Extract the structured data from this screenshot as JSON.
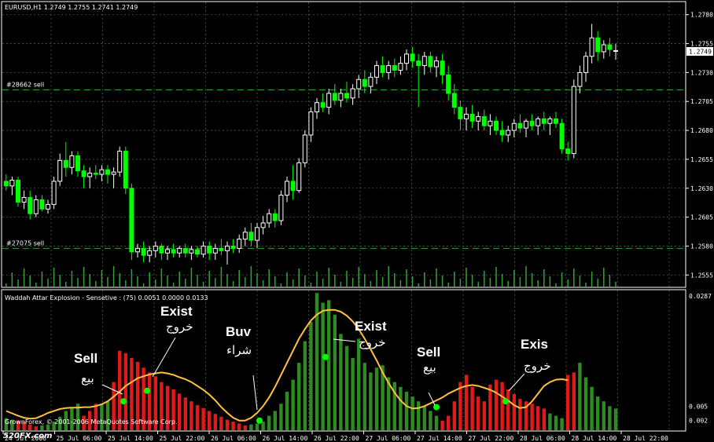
{
  "window": {
    "header": "EURUSD,H1  1.2749 1.2755 1.2741 1.2749",
    "current_price": "1.2749",
    "colors": {
      "background": "#000000",
      "grid": "#4a5a4a",
      "bull": "#ffffff",
      "bear": "#00ff00",
      "oscillator_up": "#2e8b22",
      "oscillator_down": "#e01a1a",
      "signal_line": "#ffc040",
      "marker": "#00ff00",
      "level_line": "#34a234"
    }
  },
  "price_panel": {
    "levels": [
      "1.2780",
      "1.2755",
      "1.2730",
      "1.2705",
      "1.2680",
      "1.2655",
      "1.2630",
      "1.2605",
      "1.2580",
      "1.2555"
    ],
    "level_lines": [
      {
        "label": "#28662 sell",
        "price": 1.2715
      },
      {
        "label": "#27075 sell",
        "price": 1.2578
      }
    ]
  },
  "indicator_panel": {
    "title": "Waddah Attar Explosion - Sensetive : (75)  0.0051 0.0000 0.0133",
    "levels": [
      "0.0287",
      "0.005",
      "0.002"
    ],
    "copyright": "GrownForex, © 2001-2006 MetaQuotes Software Corp."
  },
  "time_axis": [
    "24 Jul 2006",
    "25 Jul 06:00",
    "25 Jul 14:00",
    "25 Jul 22:00",
    "26 Jul 06:00",
    "26 Jul 14:00",
    "26 Jul 22:00",
    "27 Jul 06:00",
    "27 Jul 14:00",
    "27 Jul 22:00",
    "28 Jul 06:00",
    "28 Jul 14:00",
    "28 Jul 22:00"
  ],
  "annotations": [
    {
      "en": "Sell",
      "ar": "بيع"
    },
    {
      "en": "Exist",
      "ar": "خروج"
    },
    {
      "en": "Buv",
      "ar": "شراء"
    },
    {
      "en": "Exist",
      "ar": "خروج"
    },
    {
      "en": "Sell",
      "ar": "بيع"
    },
    {
      "en": "Exis",
      "ar": "خروج"
    }
  ],
  "watermark": "520FX.com",
  "chart_data": {
    "type": "candlestick",
    "symbol": "EURUSD",
    "timeframe": "H1",
    "ylim": [
      1.2545,
      1.279
    ],
    "candles": [
      [
        1.2636,
        1.2642,
        1.2628,
        1.2632
      ],
      [
        1.2632,
        1.264,
        1.2624,
        1.2637
      ],
      [
        1.2637,
        1.264,
        1.2614,
        1.2618
      ],
      [
        1.2618,
        1.2628,
        1.2612,
        1.2622
      ],
      [
        1.2622,
        1.2628,
        1.2603,
        1.2608
      ],
      [
        1.2608,
        1.2624,
        1.2605,
        1.262
      ],
      [
        1.262,
        1.2624,
        1.261,
        1.2612
      ],
      [
        1.2612,
        1.262,
        1.2608,
        1.2616
      ],
      [
        1.2616,
        1.264,
        1.2612,
        1.2636
      ],
      [
        1.2636,
        1.266,
        1.2632,
        1.2654
      ],
      [
        1.2654,
        1.267,
        1.264,
        1.2648
      ],
      [
        1.2648,
        1.2662,
        1.2642,
        1.2658
      ],
      [
        1.2658,
        1.2662,
        1.264,
        1.2645
      ],
      [
        1.2645,
        1.265,
        1.263,
        1.264
      ],
      [
        1.264,
        1.2648,
        1.263,
        1.2643
      ],
      [
        1.2643,
        1.265,
        1.2638,
        1.2642
      ],
      [
        1.2642,
        1.265,
        1.2636,
        1.2646
      ],
      [
        1.2646,
        1.265,
        1.2634,
        1.2642
      ],
      [
        1.2642,
        1.2648,
        1.263,
        1.2644
      ],
      [
        1.2644,
        1.2666,
        1.264,
        1.2662
      ],
      [
        1.2662,
        1.2666,
        1.2625,
        1.263
      ],
      [
        1.263,
        1.2634,
        1.2568,
        1.2575
      ],
      [
        1.2575,
        1.2582,
        1.257,
        1.2578
      ],
      [
        1.2578,
        1.2584,
        1.2566,
        1.2572
      ],
      [
        1.2572,
        1.258,
        1.2566,
        1.2576
      ],
      [
        1.2576,
        1.2584,
        1.257,
        1.258
      ],
      [
        1.258,
        1.2582,
        1.2568,
        1.2574
      ],
      [
        1.2574,
        1.258,
        1.2568,
        1.2577
      ],
      [
        1.2577,
        1.2582,
        1.257,
        1.2574
      ],
      [
        1.2574,
        1.258,
        1.257,
        1.2578
      ],
      [
        1.2578,
        1.2582,
        1.257,
        1.2574
      ],
      [
        1.2574,
        1.258,
        1.2568,
        1.2577
      ],
      [
        1.2577,
        1.258,
        1.257,
        1.2573
      ],
      [
        1.2573,
        1.2584,
        1.257,
        1.258
      ],
      [
        1.258,
        1.2584,
        1.2568,
        1.2574
      ],
      [
        1.2574,
        1.2582,
        1.2568,
        1.2578
      ],
      [
        1.2578,
        1.2586,
        1.2572,
        1.2576
      ],
      [
        1.2576,
        1.2584,
        1.2564,
        1.258
      ],
      [
        1.258,
        1.2586,
        1.2574,
        1.2578
      ],
      [
        1.2578,
        1.259,
        1.2574,
        1.2586
      ],
      [
        1.2586,
        1.2596,
        1.258,
        1.2592
      ],
      [
        1.2592,
        1.26,
        1.258,
        1.2585
      ],
      [
        1.2585,
        1.26,
        1.2578,
        1.2596
      ],
      [
        1.2596,
        1.2606,
        1.259,
        1.26
      ],
      [
        1.26,
        1.2612,
        1.2596,
        1.2608
      ],
      [
        1.2608,
        1.2612,
        1.2596,
        1.2602
      ],
      [
        1.2602,
        1.2628,
        1.2598,
        1.2624
      ],
      [
        1.2624,
        1.264,
        1.2618,
        1.2636
      ],
      [
        1.2636,
        1.265,
        1.262,
        1.2628
      ],
      [
        1.2628,
        1.2656,
        1.2626,
        1.2652
      ],
      [
        1.2652,
        1.268,
        1.2648,
        1.2676
      ],
      [
        1.2676,
        1.27,
        1.267,
        1.2696
      ],
      [
        1.2696,
        1.2708,
        1.269,
        1.2704
      ],
      [
        1.2704,
        1.2712,
        1.2696,
        1.27
      ],
      [
        1.27,
        1.2716,
        1.2694,
        1.2712
      ],
      [
        1.2712,
        1.272,
        1.2702,
        1.2706
      ],
      [
        1.2706,
        1.2716,
        1.27,
        1.2712
      ],
      [
        1.2712,
        1.2722,
        1.2704,
        1.2708
      ],
      [
        1.2708,
        1.272,
        1.2702,
        1.2716
      ],
      [
        1.2716,
        1.2728,
        1.2708,
        1.2724
      ],
      [
        1.2724,
        1.2732,
        1.2712,
        1.2718
      ],
      [
        1.2718,
        1.273,
        1.2712,
        1.2726
      ],
      [
        1.2726,
        1.274,
        1.272,
        1.2736
      ],
      [
        1.2736,
        1.2744,
        1.2726,
        1.273
      ],
      [
        1.273,
        1.274,
        1.2724,
        1.2736
      ],
      [
        1.2736,
        1.2742,
        1.2726,
        1.2732
      ],
      [
        1.2732,
        1.2744,
        1.2728,
        1.2738
      ],
      [
        1.2738,
        1.275,
        1.2732,
        1.2746
      ],
      [
        1.2746,
        1.2752,
        1.2734,
        1.274
      ],
      [
        1.274,
        1.2746,
        1.27,
        1.2736
      ],
      [
        1.2736,
        1.2748,
        1.2728,
        1.2744
      ],
      [
        1.2744,
        1.2748,
        1.273,
        1.2735
      ],
      [
        1.2735,
        1.2744,
        1.2726,
        1.274
      ],
      [
        1.274,
        1.2746,
        1.272,
        1.2728
      ],
      [
        1.2728,
        1.2736,
        1.2706,
        1.2712
      ],
      [
        1.2712,
        1.272,
        1.2694,
        1.27
      ],
      [
        1.27,
        1.2706,
        1.268,
        1.269
      ],
      [
        1.269,
        1.27,
        1.268,
        1.2694
      ],
      [
        1.2694,
        1.2702,
        1.2682,
        1.2688
      ],
      [
        1.2688,
        1.2696,
        1.268,
        1.2692
      ],
      [
        1.2692,
        1.2698,
        1.268,
        1.2684
      ],
      [
        1.2684,
        1.2694,
        1.2676,
        1.2688
      ],
      [
        1.2688,
        1.2692,
        1.2676,
        1.268
      ],
      [
        1.268,
        1.2688,
        1.267,
        1.2676
      ],
      [
        1.2676,
        1.2684,
        1.267,
        1.268
      ],
      [
        1.268,
        1.269,
        1.2674,
        1.2686
      ],
      [
        1.2686,
        1.2694,
        1.2678,
        1.2682
      ],
      [
        1.2682,
        1.269,
        1.2674,
        1.2688
      ],
      [
        1.2688,
        1.2694,
        1.268,
        1.2684
      ],
      [
        1.2684,
        1.2692,
        1.2676,
        1.269
      ],
      [
        1.269,
        1.2696,
        1.268,
        1.2686
      ],
      [
        1.2686,
        1.2692,
        1.2676,
        1.269
      ],
      [
        1.269,
        1.2696,
        1.2682,
        1.2686
      ],
      [
        1.2686,
        1.269,
        1.266,
        1.2664
      ],
      [
        1.2664,
        1.267,
        1.2654,
        1.266
      ],
      [
        1.266,
        1.2724,
        1.2656,
        1.2718
      ],
      [
        1.2718,
        1.2736,
        1.2712,
        1.273
      ],
      [
        1.273,
        1.2748,
        1.2722,
        1.2744
      ],
      [
        1.2744,
        1.2772,
        1.2738,
        1.276
      ],
      [
        1.276,
        1.2766,
        1.274,
        1.2748
      ],
      [
        1.2748,
        1.2758,
        1.2742,
        1.2754
      ],
      [
        1.2754,
        1.276,
        1.2744,
        1.275
      ],
      [
        1.2749,
        1.2755,
        1.2741,
        1.2749
      ]
    ],
    "histogram": [
      [
        "g",
        0.0025
      ],
      [
        "g",
        0.0022
      ],
      [
        "r",
        0.002
      ],
      [
        "r",
        0.0018
      ],
      [
        "r",
        0.0012
      ],
      [
        "r",
        0.0008
      ],
      [
        "g",
        0.001
      ],
      [
        "g",
        0.0012
      ],
      [
        "g",
        0.0018
      ],
      [
        "g",
        0.0028
      ],
      [
        "g",
        0.004
      ],
      [
        "g",
        0.0048
      ],
      [
        "g",
        0.0055
      ],
      [
        "r",
        0.003
      ],
      [
        "r",
        0.004
      ],
      [
        "r",
        0.0055
      ],
      [
        "g",
        0.0055
      ],
      [
        "g",
        0.006
      ],
      [
        "r",
        0.01
      ],
      [
        "r",
        0.0165
      ],
      [
        "r",
        0.016
      ],
      [
        "r",
        0.015
      ],
      [
        "r",
        0.0142
      ],
      [
        "r",
        0.013
      ],
      [
        "r",
        0.012
      ],
      [
        "r",
        0.0112
      ],
      [
        "r",
        0.01
      ],
      [
        "r",
        0.0092
      ],
      [
        "r",
        0.0085
      ],
      [
        "r",
        0.0076
      ],
      [
        "r",
        0.0068
      ],
      [
        "r",
        0.006
      ],
      [
        "r",
        0.0052
      ],
      [
        "r",
        0.0046
      ],
      [
        "r",
        0.004
      ],
      [
        "r",
        0.0034
      ],
      [
        "r",
        0.0028
      ],
      [
        "r",
        0.0022
      ],
      [
        "r",
        0.0018
      ],
      [
        "r",
        0.0014
      ],
      [
        "r",
        0.001
      ],
      [
        "g",
        0.0012
      ],
      [
        "g",
        0.0014
      ],
      [
        "g",
        0.0018
      ],
      [
        "g",
        0.003
      ],
      [
        "g",
        0.004
      ],
      [
        "g",
        0.0055
      ],
      [
        "g",
        0.008
      ],
      [
        "g",
        0.0105
      ],
      [
        "g",
        0.014
      ],
      [
        "g",
        0.0185
      ],
      [
        "g",
        0.0225
      ],
      [
        "g",
        0.0285
      ],
      [
        "g",
        0.0265
      ],
      [
        "g",
        0.027
      ],
      [
        "g",
        0.024
      ],
      [
        "g",
        0.02
      ],
      [
        "g",
        0.0175
      ],
      [
        "g",
        0.015
      ],
      [
        "g",
        0.019
      ],
      [
        "g",
        0.014
      ],
      [
        "g",
        0.012
      ],
      [
        "g",
        0.013
      ],
      [
        "g",
        0.0135
      ],
      [
        "g",
        0.011
      ],
      [
        "g",
        0.01
      ],
      [
        "g",
        0.009
      ],
      [
        "g",
        0.008
      ],
      [
        "g",
        0.007
      ],
      [
        "g",
        0.006
      ],
      [
        "g",
        0.005
      ],
      [
        "g",
        0.004
      ],
      [
        "g",
        0.003
      ],
      [
        "r",
        0.002
      ],
      [
        "r",
        0.003
      ],
      [
        "r",
        0.006
      ],
      [
        "r",
        0.01
      ],
      [
        "r",
        0.0115
      ],
      [
        "r",
        0.009
      ],
      [
        "r",
        0.007
      ],
      [
        "r",
        0.006
      ],
      [
        "r",
        0.0095
      ],
      [
        "r",
        0.0105
      ],
      [
        "r",
        0.01
      ],
      [
        "r",
        0.0085
      ],
      [
        "r",
        0.0075
      ],
      [
        "r",
        0.0065
      ],
      [
        "r",
        0.006
      ],
      [
        "r",
        0.0055
      ],
      [
        "r",
        0.005
      ],
      [
        "r",
        0.0045
      ],
      [
        "g",
        0.0035
      ],
      [
        "g",
        0.003
      ],
      [
        "g",
        0.0025
      ],
      [
        "r",
        0.0115
      ],
      [
        "r",
        0.012
      ],
      [
        "g",
        0.014
      ],
      [
        "g",
        0.011
      ],
      [
        "g",
        0.009
      ],
      [
        "g",
        0.007
      ],
      [
        "g",
        0.006
      ],
      [
        "g",
        0.005
      ],
      [
        "g",
        0.0045
      ]
    ],
    "signal_line_ylim": [
      0.0,
      0.0287
    ],
    "signal_line": [
      0.004,
      0.0035,
      0.003,
      0.0026,
      0.0024,
      0.0025,
      0.003,
      0.0036,
      0.004,
      0.0044,
      0.0046,
      0.0047,
      0.0047,
      0.0048,
      0.0048,
      0.005,
      0.0054,
      0.006,
      0.007,
      0.008,
      0.0092,
      0.01,
      0.0108,
      0.0112,
      0.0116,
      0.0118,
      0.012,
      0.0118,
      0.0115,
      0.011,
      0.0106,
      0.01,
      0.0092,
      0.0084,
      0.0074,
      0.0062,
      0.0048,
      0.0036,
      0.0026,
      0.002,
      0.002,
      0.0026,
      0.0036,
      0.005,
      0.0068,
      0.009,
      0.0115,
      0.014,
      0.0165,
      0.019,
      0.021,
      0.0228,
      0.024,
      0.0248,
      0.025,
      0.025,
      0.0246,
      0.0238,
      0.0226,
      0.021,
      0.019,
      0.0168,
      0.0145,
      0.012,
      0.0098,
      0.0078,
      0.0062,
      0.005,
      0.0045,
      0.0046,
      0.005,
      0.0056,
      0.0062,
      0.0068,
      0.0076,
      0.0082,
      0.0088,
      0.0092,
      0.0094,
      0.0092,
      0.0088,
      0.0084,
      0.0078,
      0.007,
      0.0062,
      0.0052,
      0.0046,
      0.0048,
      0.006,
      0.0076,
      0.0092,
      0.01,
      0.0105,
      0.0106,
      0.0104
    ]
  }
}
